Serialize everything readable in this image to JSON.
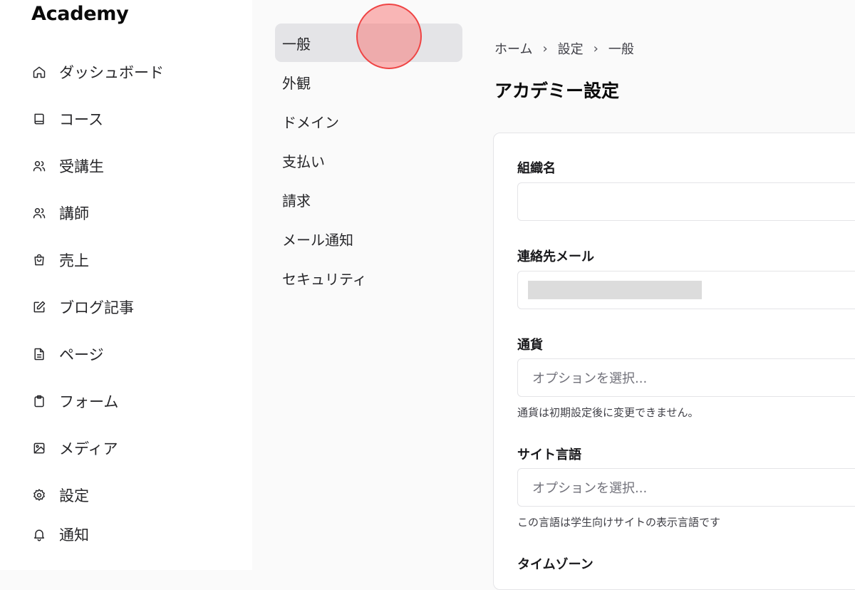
{
  "app": {
    "brand": "Academy"
  },
  "sidebar": {
    "items": [
      {
        "label": "ダッシュボード",
        "icon": "home-icon"
      },
      {
        "label": "コース",
        "icon": "book-icon"
      },
      {
        "label": "受講生",
        "icon": "users-icon"
      },
      {
        "label": "講師",
        "icon": "users-icon"
      },
      {
        "label": "売上",
        "icon": "shopping-bag-icon"
      },
      {
        "label": "ブログ記事",
        "icon": "edit-icon"
      },
      {
        "label": "ページ",
        "icon": "file-text-icon"
      },
      {
        "label": "フォーム",
        "icon": "clipboard-icon"
      },
      {
        "label": "メディア",
        "icon": "image-icon"
      },
      {
        "label": "設定",
        "icon": "gear-icon"
      },
      {
        "label": "通知",
        "icon": "bell-icon"
      }
    ]
  },
  "settings_nav": {
    "items": [
      {
        "label": "一般",
        "active": true
      },
      {
        "label": "外観"
      },
      {
        "label": "ドメイン"
      },
      {
        "label": "支払い"
      },
      {
        "label": "請求"
      },
      {
        "label": "メール通知"
      },
      {
        "label": "セキュリティ"
      }
    ]
  },
  "breadcrumb": [
    "ホーム",
    "設定",
    "一般"
  ],
  "page": {
    "title": "アカデミー設定"
  },
  "form": {
    "org_name": {
      "label": "組織名",
      "value": ""
    },
    "contact_email": {
      "label": "連絡先メール"
    },
    "currency": {
      "label": "通貨",
      "placeholder": "オプションを選択...",
      "helper": "通貨は初期設定後に変更できません。"
    },
    "site_language": {
      "label": "サイト言語",
      "placeholder": "オプションを選択...",
      "helper": "この言語は学生向けサイトの表示言語です"
    },
    "timezone": {
      "label": "タイムゾーン"
    }
  },
  "colors": {
    "active_bg": "#e4e4e7",
    "cursor_marker": "#ef4444"
  }
}
